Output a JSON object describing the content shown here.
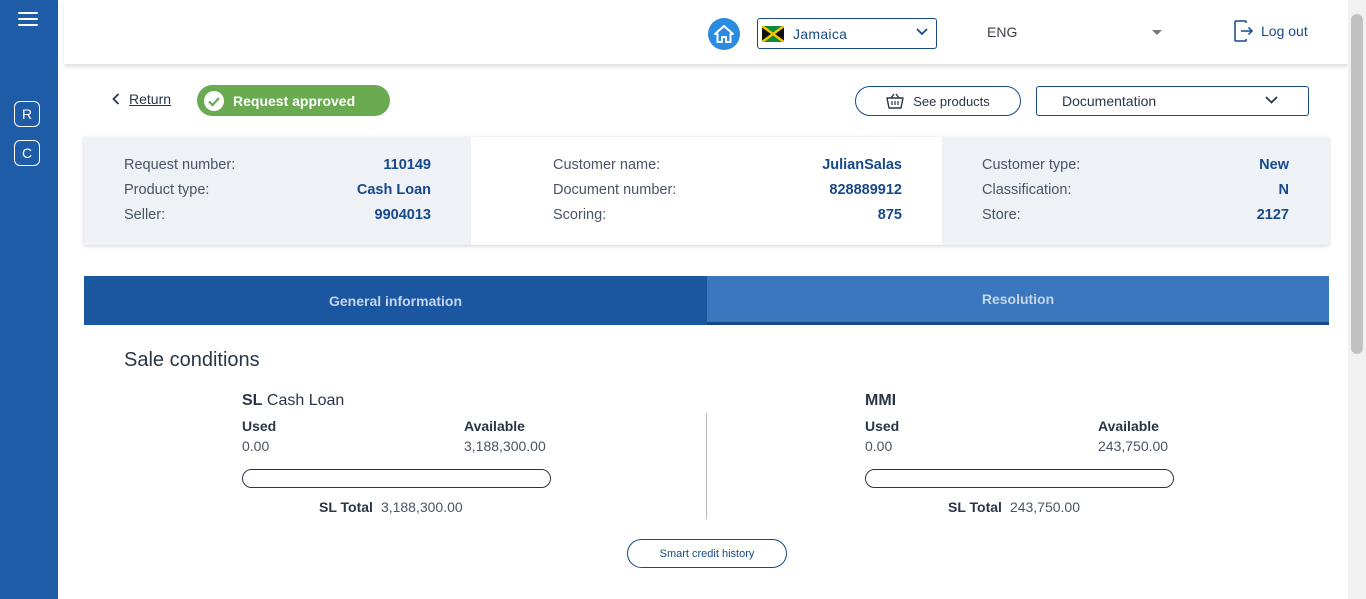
{
  "sidebar": {
    "buttons": [
      {
        "letter": "R"
      },
      {
        "letter": "C"
      }
    ]
  },
  "header": {
    "country": "Jamaica",
    "language": "ENG",
    "logout_label": "Log out"
  },
  "request": {
    "return_label": "Return",
    "status": "Request approved",
    "see_products_label": "See products",
    "documentation_label": "Documentation"
  },
  "info": {
    "col1": [
      {
        "label": "Request number:",
        "value": "110149"
      },
      {
        "label": "Product type:",
        "value": "Cash Loan"
      },
      {
        "label": "Seller:",
        "value": "9904013"
      }
    ],
    "col2": [
      {
        "label": "Customer name:",
        "value": "JulianSalas"
      },
      {
        "label": "Document number:",
        "value": "828889912"
      },
      {
        "label": "Scoring:",
        "value": "875"
      }
    ],
    "col3": [
      {
        "label": "Customer type:",
        "value": "New"
      },
      {
        "label": "Classification:",
        "value": "N"
      },
      {
        "label": "Store:",
        "value": "2127"
      }
    ]
  },
  "tabs": [
    {
      "label": "General information",
      "active": true
    },
    {
      "label": "Resolution",
      "active": false
    }
  ],
  "sale_conditions": {
    "title": "Sale conditions",
    "left": {
      "title_bold": "SL",
      "title_rest": "Cash Loan",
      "used_label": "Used",
      "used_value": "0.00",
      "available_label": "Available",
      "available_value": "3,188,300.00",
      "usage_fraction": 0,
      "total_label": "SL Total",
      "total_value": "3,188,300.00"
    },
    "right": {
      "title_bold": "MMI",
      "title_rest": "",
      "used_label": "Used",
      "used_value": "0.00",
      "available_label": "Available",
      "available_value": "243,750.00",
      "usage_fraction": 0,
      "total_label": "SL Total",
      "total_value": "243,750.00"
    },
    "history_label": "Smart credit history"
  },
  "colors": {
    "sidebar": "#1f5ca8",
    "primary": "#17498a",
    "success": "#6aab52",
    "tab_active": "#1b56a0",
    "tab_inactive": "#3a77bf"
  }
}
